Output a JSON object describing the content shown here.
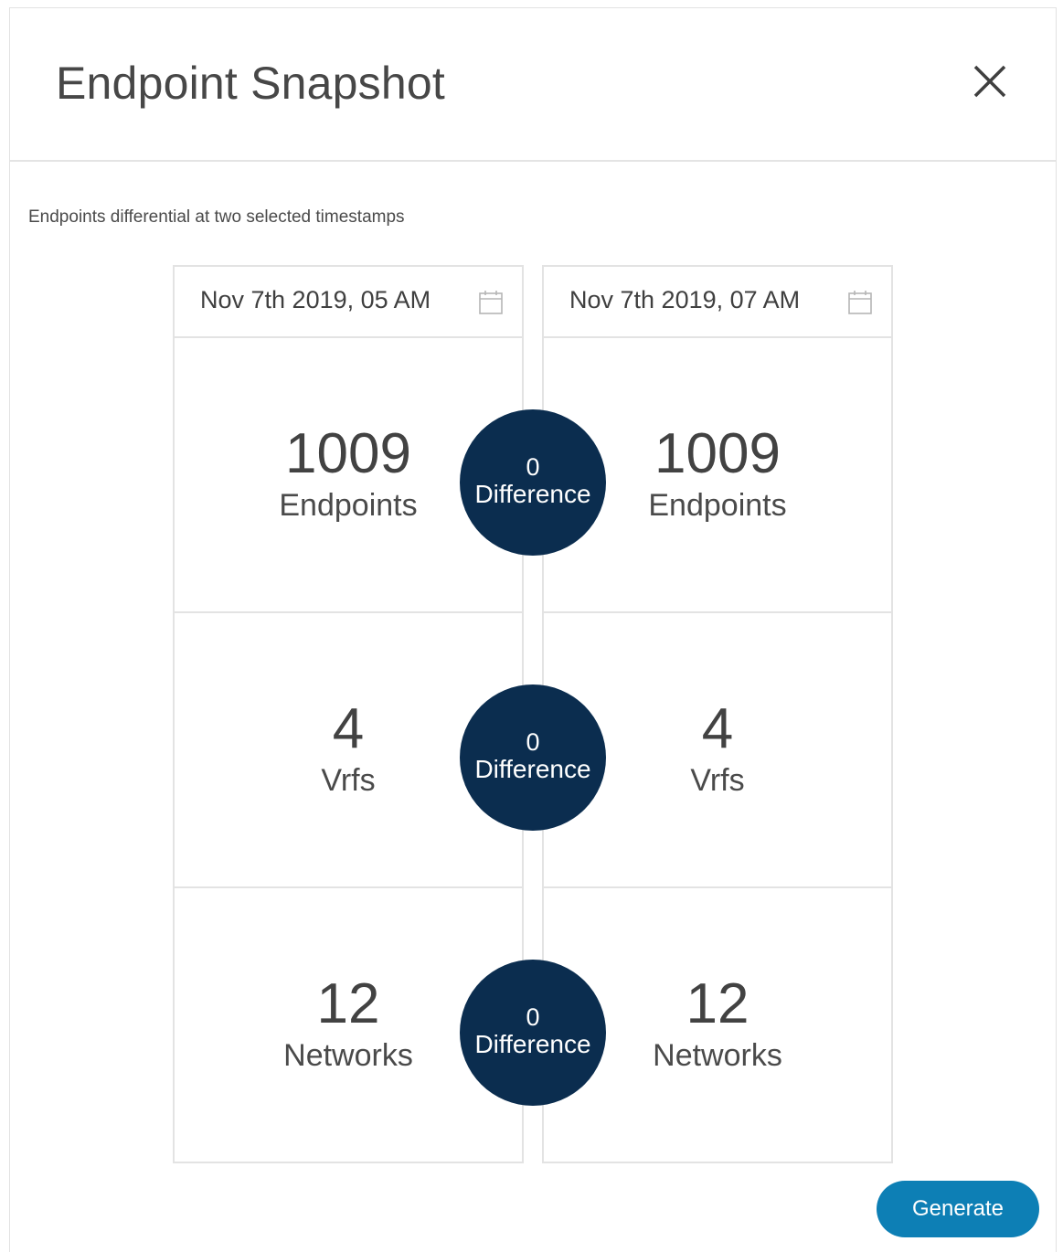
{
  "modal": {
    "title": "Endpoint Snapshot",
    "close_label": "X",
    "subtitle": "Endpoints differential at two selected timestamps"
  },
  "snapshots": [
    {
      "timestamp": "Nov 7th 2019, 05 AM",
      "calendar_icon": "calendar-icon",
      "metrics": [
        {
          "value": "1009",
          "label": "Endpoints"
        },
        {
          "value": "4",
          "label": "Vrfs"
        },
        {
          "value": "12",
          "label": "Networks"
        }
      ]
    },
    {
      "timestamp": "Nov 7th 2019, 07 AM",
      "calendar_icon": "calendar-icon",
      "metrics": [
        {
          "value": "1009",
          "label": "Endpoints"
        },
        {
          "value": "4",
          "label": "Vrfs"
        },
        {
          "value": "12",
          "label": "Networks"
        }
      ]
    }
  ],
  "differences": [
    {
      "value": "0",
      "label": "Difference"
    },
    {
      "value": "0",
      "label": "Difference"
    },
    {
      "value": "0",
      "label": "Difference"
    }
  ],
  "actions": {
    "generate_label": "Generate"
  },
  "colors": {
    "difference_bubble": "#0b2d4f",
    "primary_button": "#0d7fb5",
    "border": "#e3e3e3"
  }
}
